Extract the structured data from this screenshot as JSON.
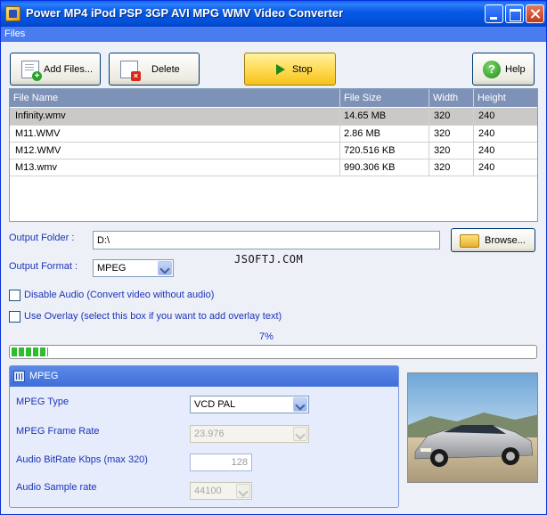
{
  "window": {
    "title": "Power MP4 iPod PSP 3GP AVI MPG WMV Video Converter"
  },
  "menu": {
    "files_label": "Files"
  },
  "toolbar": {
    "add_files_label": "Add Files...",
    "delete_label": "Delete",
    "stop_label": "Stop",
    "help_label": "Help"
  },
  "file_list": {
    "columns": [
      "File Name",
      "File Size",
      "Width",
      "Height"
    ],
    "rows": [
      {
        "name": "Infinity.wmv",
        "size": "14.65 MB",
        "width": "320",
        "height": "240",
        "selected": true
      },
      {
        "name": "M11.WMV",
        "size": "2.86 MB",
        "width": "320",
        "height": "240",
        "selected": false
      },
      {
        "name": "M12.WMV",
        "size": "720.516 KB",
        "width": "320",
        "height": "240",
        "selected": false
      },
      {
        "name": "M13.wmv",
        "size": "990.306 KB",
        "width": "320",
        "height": "240",
        "selected": false
      }
    ]
  },
  "output": {
    "folder_label": "Output Folder :",
    "folder_value": "D:\\",
    "browse_label": "Browse...",
    "format_label": "Output Format :",
    "format_value": "MPEG"
  },
  "watermark": "JSOFTJ.COM",
  "options": {
    "disable_audio_label": "Disable Audio (Convert video without audio)",
    "use_overlay_label": "Use Overlay (select this box if you want to add overlay text)"
  },
  "progress": {
    "percent": 7,
    "text": "7%"
  },
  "mpeg_panel": {
    "title": "MPEG",
    "type_label": "MPEG Type",
    "type_value": "VCD PAL",
    "frame_rate_label": "MPEG Frame Rate",
    "frame_rate_value": "23.976",
    "bitrate_label": "Audio BitRate Kbps (max 320)",
    "bitrate_value": "128",
    "sample_rate_label": "Audio Sample rate",
    "sample_rate_value": "44100"
  },
  "colors": {
    "title_bar": "#0558e6",
    "menu_bar": "#4a7cf0",
    "label_text": "#1c34b8",
    "progress_fill": "#2fbd2f",
    "list_header": "#7e92b8"
  }
}
